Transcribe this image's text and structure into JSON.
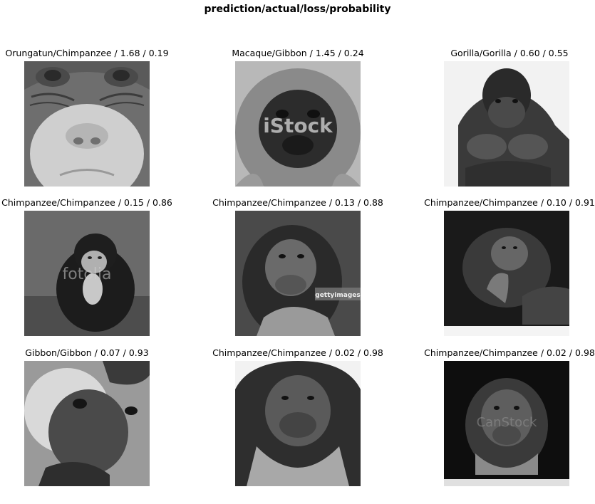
{
  "suptitle": "prediction/actual/loss/probability",
  "grid": [
    {
      "title": "Orungatun/Chimpanzee / 1.68 / 0.19",
      "image": "orangutan-face-closeup"
    },
    {
      "title": "Macaque/Gibbon / 1.45 / 0.24",
      "image": "gibbon-face-istock-watermark",
      "watermark": "iStock"
    },
    {
      "title": "Gorilla/Gorilla / 0.60 / 0.55",
      "image": "gorilla-portrait"
    },
    {
      "title": "Chimpanzee/Chimpanzee / 0.15 / 0.86",
      "image": "young-chimp-fotolia-watermark",
      "watermark": "fotolia"
    },
    {
      "title": "Chimpanzee/Chimpanzee / 0.13 / 0.88",
      "image": "chimp-gettyimages-watermark",
      "watermark": "gettyimages"
    },
    {
      "title": "Chimpanzee/Chimpanzee / 0.10 / 0.91",
      "image": "chimp-thinking-dark-background"
    },
    {
      "title": "Gibbon/Gibbon / 0.07 / 0.93",
      "image": "gibbon-face-closeup"
    },
    {
      "title": "Chimpanzee/Chimpanzee / 0.02 / 0.98",
      "image": "chimp-portrait-white-background"
    },
    {
      "title": "Chimpanzee/Chimpanzee / 0.02 / 0.98",
      "image": "chimp-portrait-black-background",
      "watermark": "CanStock"
    }
  ]
}
